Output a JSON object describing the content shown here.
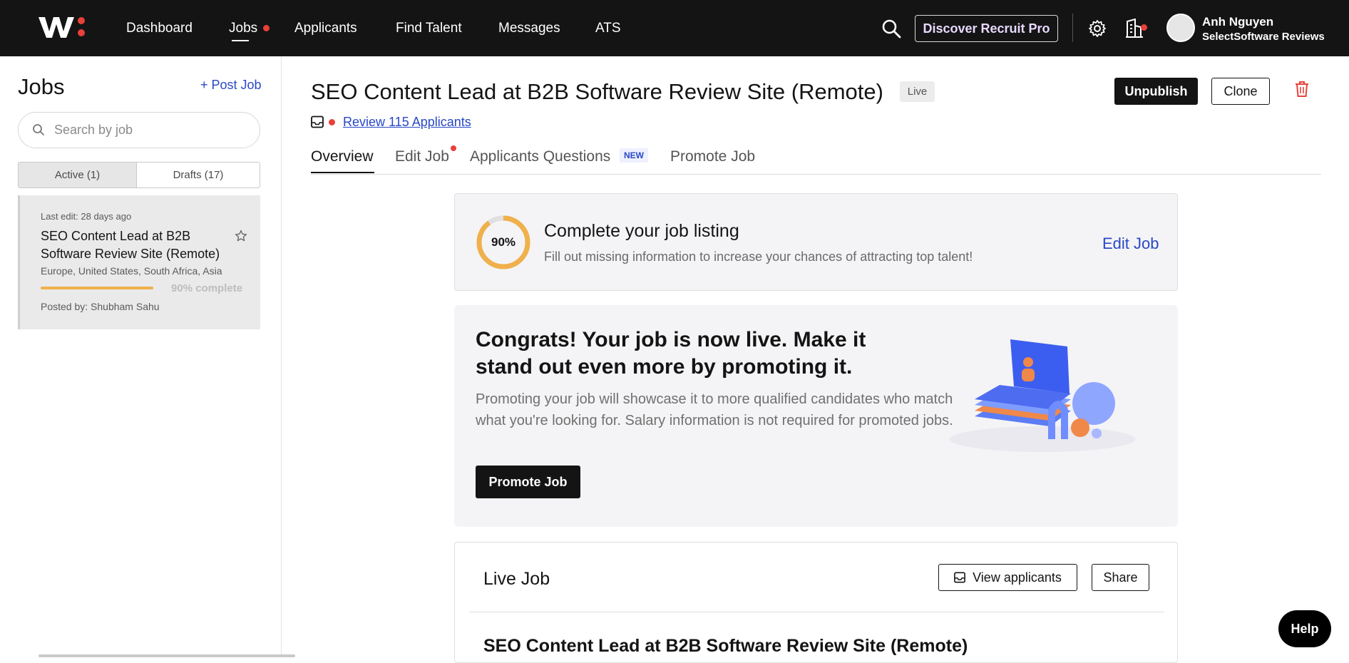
{
  "nav": {
    "items": [
      {
        "label": "Dashboard"
      },
      {
        "label": "Jobs"
      },
      {
        "label": "Applicants"
      },
      {
        "label": "Find Talent"
      },
      {
        "label": "Messages"
      },
      {
        "label": "ATS"
      }
    ],
    "active": "Jobs",
    "discover_label": "Discover Recruit Pro",
    "user": {
      "name": "Anh Nguyen",
      "company": "SelectSoftware Reviews"
    },
    "accent_dot_color": "#e8413a"
  },
  "sidebar": {
    "title": "Jobs",
    "post_job_label": "+ Post Job",
    "search_placeholder": "Search by job",
    "tabs": [
      {
        "label": "Active (1)"
      },
      {
        "label": "Drafts (17)"
      }
    ],
    "job": {
      "last_edit": "Last edit: 28 days ago",
      "title": "SEO Content Lead at B2B Software Review Site (Remote)",
      "location": "Europe, United States, South Africa, Asia",
      "progress_fraction": 0.9,
      "progress_label": "90% complete",
      "posted_by": "Posted by: Shubham Sahu"
    }
  },
  "main": {
    "title": "SEO Content Lead at B2B Software Review Site (Remote)",
    "status_badge": "Live",
    "unpublish_label": "Unpublish",
    "clone_label": "Clone",
    "review_link": "Review 115 Applicants",
    "tabs": [
      {
        "label": "Overview"
      },
      {
        "label": "Edit Job"
      },
      {
        "label": "Applicants Questions"
      },
      {
        "label": "Promote Job"
      }
    ],
    "new_badge": "NEW",
    "complete_card": {
      "percent_label": "90%",
      "percent": 90,
      "title": "Complete your job listing",
      "subtitle": "Fill out missing information to increase your chances of attracting top talent!",
      "edit_label": "Edit Job",
      "ring_color": "#f0b04b"
    },
    "promote_card": {
      "title": "Congrats! Your job is now live. Make it stand out even more by promoting it.",
      "body": "Promoting your job will showcase it to more qualified candidates who match what you're looking for. Salary information is not required for promoted jobs.",
      "button_label": "Promote Job"
    },
    "live_card": {
      "title": "Live Job",
      "view_label": "View applicants",
      "share_label": "Share",
      "job_title": "SEO Content Lead at B2B Software Review Site (Remote)"
    }
  },
  "help_label": "Help",
  "link_color": "#2948c5"
}
